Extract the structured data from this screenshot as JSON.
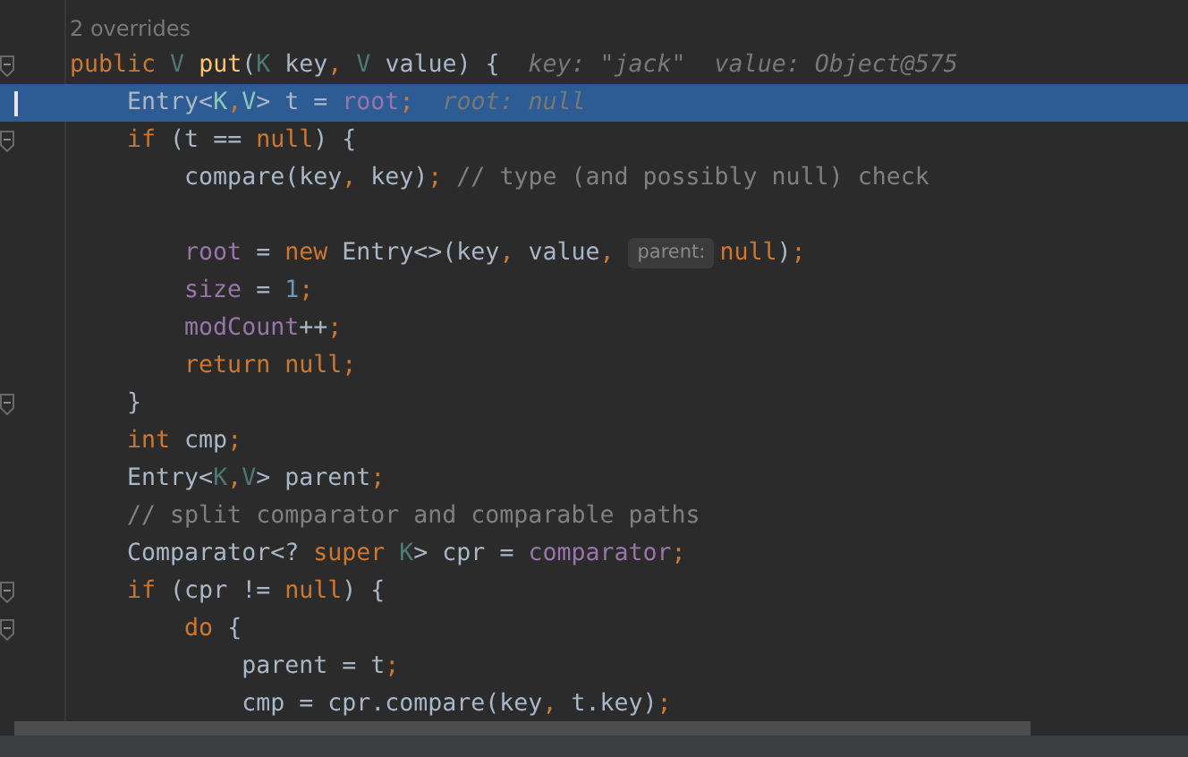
{
  "editor": {
    "code_vision": "2 overrides",
    "lines": [
      {
        "fold": true,
        "current": false,
        "tokens": [
          {
            "kind": "keyword",
            "text": "public "
          },
          {
            "kind": "typeparam",
            "text": "V "
          },
          {
            "kind": "method",
            "text": "put"
          },
          {
            "kind": "plain",
            "text": "("
          },
          {
            "kind": "typeparam",
            "text": "K "
          },
          {
            "kind": "plain",
            "text": "key"
          },
          {
            "kind": "keyword",
            "text": ", "
          },
          {
            "kind": "typeparam",
            "text": "V "
          },
          {
            "kind": "plain",
            "text": "value) {"
          },
          {
            "kind": "hint",
            "text": "key: \"jack\""
          },
          {
            "kind": "hint",
            "text": "value: Object@575"
          }
        ]
      },
      {
        "fold": false,
        "current": true,
        "tokens": [
          {
            "kind": "plain",
            "text": "    Entry<"
          },
          {
            "kind": "typeparam",
            "text": "K"
          },
          {
            "kind": "keyword",
            "text": ","
          },
          {
            "kind": "typeparam",
            "text": "V"
          },
          {
            "kind": "plain",
            "text": "> t = "
          },
          {
            "kind": "field",
            "text": "root"
          },
          {
            "kind": "keyword",
            "text": ";"
          },
          {
            "kind": "hint",
            "text": "root: null"
          }
        ]
      },
      {
        "fold": true,
        "current": false,
        "tokens": [
          {
            "kind": "keyword",
            "text": "    if "
          },
          {
            "kind": "plain",
            "text": "(t == "
          },
          {
            "kind": "keyword",
            "text": "null"
          },
          {
            "kind": "plain",
            "text": ") {"
          }
        ]
      },
      {
        "fold": false,
        "current": false,
        "tokens": [
          {
            "kind": "plain",
            "text": "        compare(key"
          },
          {
            "kind": "keyword",
            "text": ", "
          },
          {
            "kind": "plain",
            "text": "key)"
          },
          {
            "kind": "keyword",
            "text": "; "
          },
          {
            "kind": "comment",
            "text": "// type (and possibly null) check"
          }
        ]
      },
      {
        "fold": false,
        "current": false
      },
      {
        "fold": false,
        "current": false,
        "tokens": [
          {
            "kind": "field",
            "text": "        root "
          },
          {
            "kind": "plain",
            "text": "= "
          },
          {
            "kind": "keyword",
            "text": "new "
          },
          {
            "kind": "plain",
            "text": "Entry<>(key"
          },
          {
            "kind": "keyword",
            "text": ", "
          },
          {
            "kind": "plain",
            "text": "value"
          },
          {
            "kind": "keyword",
            "text": ", "
          },
          {
            "kind": "inlay",
            "text": "parent:"
          },
          {
            "kind": "keyword",
            "text": "null"
          },
          {
            "kind": "plain",
            "text": ")"
          },
          {
            "kind": "keyword",
            "text": ";"
          }
        ]
      },
      {
        "fold": false,
        "current": false,
        "tokens": [
          {
            "kind": "field",
            "text": "        size "
          },
          {
            "kind": "plain",
            "text": "= "
          },
          {
            "kind": "number",
            "text": "1"
          },
          {
            "kind": "keyword",
            "text": ";"
          }
        ]
      },
      {
        "fold": false,
        "current": false,
        "tokens": [
          {
            "kind": "field",
            "text": "        modCount"
          },
          {
            "kind": "plain",
            "text": "++"
          },
          {
            "kind": "keyword",
            "text": ";"
          }
        ]
      },
      {
        "fold": false,
        "current": false,
        "tokens": [
          {
            "kind": "keyword",
            "text": "        return null;"
          }
        ]
      },
      {
        "fold": true,
        "current": false,
        "tokens": [
          {
            "kind": "plain",
            "text": "    }"
          }
        ]
      },
      {
        "fold": false,
        "current": false,
        "tokens": [
          {
            "kind": "keyword",
            "text": "    int "
          },
          {
            "kind": "plain",
            "text": "cmp"
          },
          {
            "kind": "keyword",
            "text": ";"
          }
        ]
      },
      {
        "fold": false,
        "current": false,
        "tokens": [
          {
            "kind": "plain",
            "text": "    Entry<"
          },
          {
            "kind": "typeparam",
            "text": "K"
          },
          {
            "kind": "keyword",
            "text": ","
          },
          {
            "kind": "typeparam",
            "text": "V"
          },
          {
            "kind": "plain",
            "text": "> parent"
          },
          {
            "kind": "keyword",
            "text": ";"
          }
        ]
      },
      {
        "fold": false,
        "current": false,
        "tokens": [
          {
            "kind": "comment",
            "text": "    // split comparator and comparable paths"
          }
        ]
      },
      {
        "fold": false,
        "current": false,
        "tokens": [
          {
            "kind": "plain",
            "text": "    Comparator<? "
          },
          {
            "kind": "keyword",
            "text": "super "
          },
          {
            "kind": "typeparam",
            "text": "K"
          },
          {
            "kind": "plain",
            "text": "> cpr = "
          },
          {
            "kind": "field",
            "text": "comparator"
          },
          {
            "kind": "keyword",
            "text": ";"
          }
        ]
      },
      {
        "fold": true,
        "current": false,
        "tokens": [
          {
            "kind": "keyword",
            "text": "    if "
          },
          {
            "kind": "plain",
            "text": "(cpr != "
          },
          {
            "kind": "keyword",
            "text": "null"
          },
          {
            "kind": "plain",
            "text": ") {"
          }
        ]
      },
      {
        "fold": true,
        "current": false,
        "tokens": [
          {
            "kind": "keyword",
            "text": "        do "
          },
          {
            "kind": "plain",
            "text": "{"
          }
        ]
      },
      {
        "fold": false,
        "current": false,
        "tokens": [
          {
            "kind": "plain",
            "text": "            parent = t"
          },
          {
            "kind": "keyword",
            "text": ";"
          }
        ]
      },
      {
        "fold": false,
        "current": false,
        "tokens": [
          {
            "kind": "plain",
            "text": "            cmp = cpr.compare(key"
          },
          {
            "kind": "keyword",
            "text": ", "
          },
          {
            "kind": "plain",
            "text": "t.key)"
          },
          {
            "kind": "keyword",
            "text": ";"
          }
        ]
      }
    ]
  }
}
